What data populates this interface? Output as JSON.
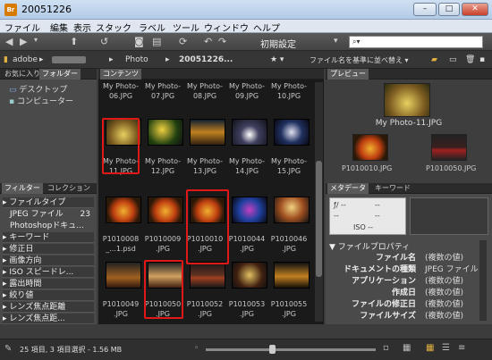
{
  "window": {
    "title": "20051226",
    "app_badge": "Br",
    "min": "–",
    "max": "□",
    "close": "✕"
  },
  "menu": [
    "ファイル",
    "編集",
    "表示",
    "スタック",
    "ラベル",
    "ツール",
    "ウィンドウ",
    "ヘルプ"
  ],
  "toolbar": {
    "workspace": "初期設定",
    "workspace_arrow": "▾",
    "search_glyph": "⌕▾"
  },
  "path": {
    "items": [
      "adobe",
      "▸",
      "▸",
      "Photo",
      "▸",
      "20051226..."
    ],
    "star": "★ ▾",
    "sort": "ファイル名を基準に並べ替え ▾"
  },
  "favorites": {
    "tabs": [
      "お気に入り",
      "フォルダー"
    ],
    "items": [
      "デスクトップ",
      "コンピューター"
    ]
  },
  "filter": {
    "tabs": [
      "フィルター",
      "コレクション"
    ],
    "rows": [
      {
        "label": "ファイルタイプ",
        "hdr": true
      },
      {
        "label": "JPEG ファイル",
        "count": "23",
        "hdr": false
      },
      {
        "label": "Photoshopドキュ...",
        "hdr": false
      },
      {
        "label": "キーワード",
        "hdr": true
      },
      {
        "label": "修正日",
        "hdr": true
      },
      {
        "label": "画像方向",
        "hdr": true
      },
      {
        "label": "ISO スピードレ...",
        "hdr": true
      },
      {
        "label": "露出時間",
        "hdr": true
      },
      {
        "label": "絞り値",
        "hdr": true
      },
      {
        "label": "レンズ焦点距離",
        "hdr": true
      },
      {
        "label": "レンズ焦点距...",
        "hdr": true
      }
    ]
  },
  "content": {
    "tab": "コンテンツ",
    "top_captions": [
      "My Photo-\n06.JPG",
      "My Photo-\n07.JPG",
      "My Photo-\n08.JPG",
      "My Photo-\n09.JPG",
      "My Photo-\n10.JPG"
    ],
    "row2_captions": [
      "My Photo-\n11.JPG",
      "My Photo-\n12.JPG",
      "My Photo-\n13.JPG",
      "My Photo-\n14.JPG",
      "My Photo-\n15.JPG"
    ],
    "row3_captions": [
      "P1010008\n_...1.psd",
      "P1010009\n.JPG",
      "P1010010\n.JPG",
      "P1010044\n.JPG",
      "P1010046\n.JPG"
    ],
    "row4_captions": [
      "P1010049\n.JPG",
      "P1010050\n.JPG",
      "P1010052\n.JPG",
      "P1010053\n.JPG",
      "P1010055\n.JPG"
    ]
  },
  "preview": {
    "tab": "プレビュー",
    "main_caption": "My Photo-11.JPG",
    "sub_captions": [
      "P1010010.JPG",
      "P1010050.JPG"
    ]
  },
  "metadata": {
    "tabs": [
      "メタデータ",
      "キーワード"
    ],
    "camera": {
      "aperture": "ƒ/ --",
      "dash1": "--",
      "dash2": "--",
      "dash3": "--",
      "iso": "ISO --"
    },
    "section": "ファイルプロパティ",
    "rows": [
      {
        "key": "ファイル名",
        "val": "(複数の値)"
      },
      {
        "key": "ドキュメントの種類",
        "val": "JPEG ファイル"
      },
      {
        "key": "アプリケーション",
        "val": "(複数の値)"
      },
      {
        "key": "作成日",
        "val": "(複数の値)"
      },
      {
        "key": "ファイルの修正日",
        "val": "(複数の値)"
      },
      {
        "key": "ファイルサイズ",
        "val": "(複数の値)"
      }
    ]
  },
  "status": {
    "text": "25 項目, 3 項目選択 - 1.56 MB"
  },
  "colors": {
    "selection": "#e01818",
    "accent": "#d77a00"
  }
}
